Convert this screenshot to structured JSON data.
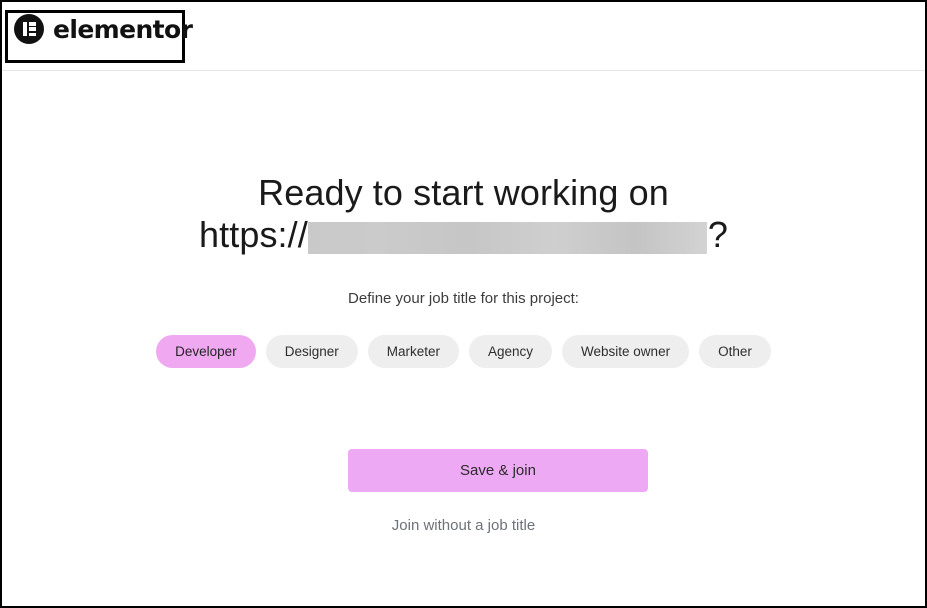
{
  "header": {
    "logo_icon": "elementor-logo-icon",
    "brand": "elementor"
  },
  "main": {
    "headline_line1": "Ready to start working on",
    "headline_prefix": "https://",
    "headline_redacted_url": "[redacted]",
    "headline_suffix": "?",
    "subtitle": "Define your job title for this project:",
    "job_titles": [
      {
        "label": "Developer",
        "selected": true
      },
      {
        "label": "Designer",
        "selected": false
      },
      {
        "label": "Marketer",
        "selected": false
      },
      {
        "label": "Agency",
        "selected": false
      },
      {
        "label": "Website owner",
        "selected": false
      },
      {
        "label": "Other",
        "selected": false
      }
    ],
    "primary_action": "Save & join",
    "secondary_action": "Join without a job title"
  },
  "colors": {
    "accent": "#eea9f5",
    "pill_selected": "#f0a9f0",
    "pill_default": "#eeeeee",
    "text_primary": "#1a1a1a",
    "text_muted": "#6d7278",
    "redaction": "#c9c9c9"
  }
}
